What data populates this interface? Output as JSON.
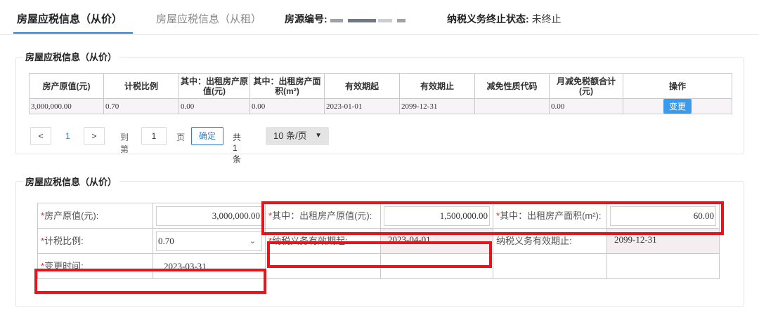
{
  "tabs": [
    {
      "label": "房屋应税信息（从价）"
    },
    {
      "label": "房屋应税信息（从租）"
    }
  ],
  "source_no_label": "房源编号:",
  "tax_status_label": "纳税义务终止状态:",
  "tax_status_value": "未终止",
  "panel1": {
    "title": "房屋应税信息（从价）",
    "headers": [
      "房产原值(元)",
      "计税比例",
      "其中：出租房产原值(元)",
      "其中：出租房产面积(m²)",
      "有效期起",
      "有效期止",
      "减免性质代码",
      "月减免税额合计(元)",
      "操作"
    ],
    "row": [
      "3,000,000.00",
      "0.70",
      "0.00",
      "0.00",
      "2023-01-01",
      "2099-12-31",
      "",
      "0.00"
    ],
    "action_label": "变更"
  },
  "pager": {
    "prev": "<",
    "current_page": "1",
    "next": ">",
    "goto_label": "到第",
    "goto_value": "1",
    "page_unit": "页",
    "confirm": "确定",
    "total": "共 1 条",
    "page_size": "10 条/页"
  },
  "panel2": {
    "title": "房屋应税信息（从价）",
    "original_value_label": "房产原值(元):",
    "original_value": "3,000,000.00",
    "rented_value_label": "其中：出租房产原值(元):",
    "rented_value": "1,500,000.00",
    "rented_area_label": "其中：出租房产面积(m²):",
    "rented_area": "60.00",
    "tax_ratio_label": "计税比例:",
    "tax_ratio": "0.70",
    "start_label": "纳税义务有效期起:",
    "start_date": "2023-04-01",
    "end_label": "纳税义务有效期止:",
    "end_date": "2099-12-31",
    "change_time_label": "变更时间:",
    "change_time": "2023-03-31"
  },
  "colors": {
    "accent": "#2f7fd1",
    "button": "#3a9bea",
    "highlight": "#e8141c",
    "required": "#e0232d"
  }
}
